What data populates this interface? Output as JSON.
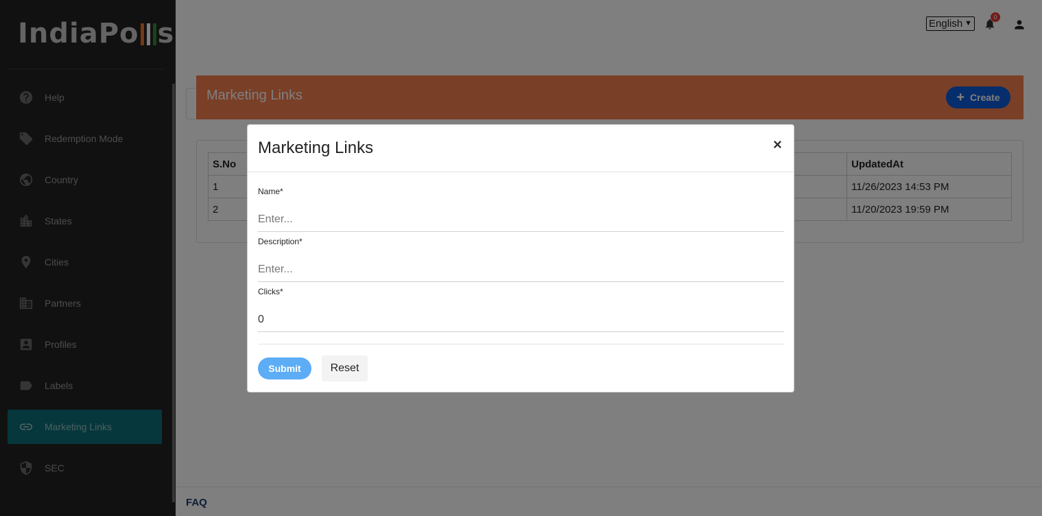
{
  "brand": {
    "logo_part1": "IndiaPo",
    "logo_part2": "s",
    "flag_colors": [
      "#e8742a",
      "#ffffff",
      "#2e8b2e"
    ]
  },
  "sidebar": {
    "items": [
      {
        "label": "Help",
        "icon": "help-icon"
      },
      {
        "label": "Redemption Mode",
        "icon": "tag-icon"
      },
      {
        "label": "Country",
        "icon": "globe-icon"
      },
      {
        "label": "States",
        "icon": "city-icon"
      },
      {
        "label": "Cities",
        "icon": "location-pin-icon"
      },
      {
        "label": "Partners",
        "icon": "building-icon"
      },
      {
        "label": "Profiles",
        "icon": "profile-icon"
      },
      {
        "label": "Labels",
        "icon": "label-icon"
      },
      {
        "label": "Marketing Links",
        "icon": "link-icon",
        "active": true
      },
      {
        "label": "SEC",
        "icon": "shield-icon"
      }
    ]
  },
  "topbar": {
    "language": "English",
    "notification_count": "0"
  },
  "page": {
    "title": "Marketing Links",
    "create_label": "Create"
  },
  "table": {
    "headers": [
      "S.No",
      "",
      "UpdatedAt"
    ],
    "rows": [
      [
        "1",
        "",
        "11/26/2023 14:53 PM"
      ],
      [
        "2",
        "",
        "11/20/2023 19:59 PM"
      ]
    ]
  },
  "footer": {
    "faq": "FAQ"
  },
  "modal": {
    "title": "Marketing Links",
    "close": "×",
    "fields": [
      {
        "label": "Name*",
        "value": "",
        "placeholder": "Enter..."
      },
      {
        "label": "Description*",
        "value": "",
        "placeholder": "Enter..."
      },
      {
        "label": "Clicks*",
        "value": "0",
        "placeholder": ""
      }
    ],
    "submit_label": "Submit",
    "reset_label": "Reset"
  },
  "colors": {
    "sidebar_bg": "#222222",
    "active_item": "#0d6f79",
    "header_band": "#f37f4f",
    "create_button": "#0d5bd8",
    "submit_button": "#5cacf6"
  }
}
